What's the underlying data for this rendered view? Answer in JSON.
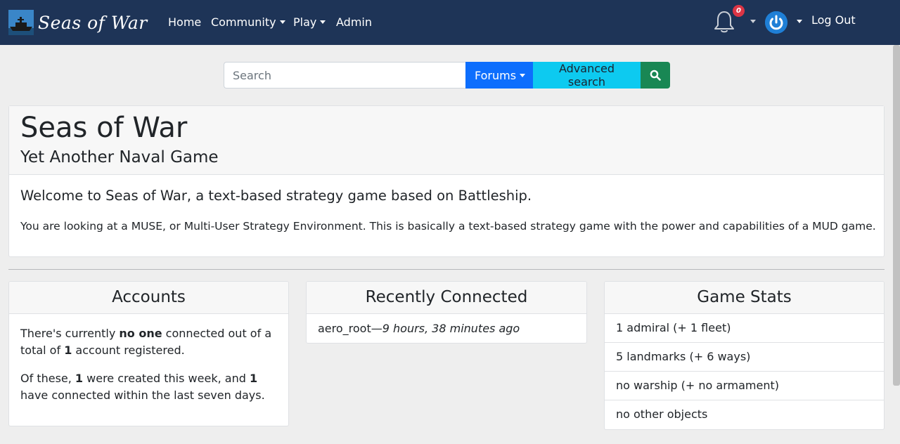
{
  "nav": {
    "brand": "Seas of War",
    "links": {
      "home": "Home",
      "community": "Community",
      "play": "Play",
      "admin": "Admin"
    },
    "notification_count": "0",
    "logout": "Log Out",
    "icons": [
      "ship-logo-icon",
      "bell-icon",
      "power-icon",
      "search-icon"
    ]
  },
  "search": {
    "placeholder": "Search",
    "forums_label": "Forums",
    "advanced_label": "Advanced search"
  },
  "hero": {
    "title": "Seas of War",
    "subtitle": "Yet Another Naval Game",
    "lead": "Welcome to Seas of War, a text-based strategy game based on Battleship.",
    "text": "You are looking at a MUSE, or Multi-User Strategy Environment. This is basically a text-based strategy game with the power and capabilities of a MUD game."
  },
  "accounts": {
    "title": "Accounts",
    "p1": {
      "a": "There's currently ",
      "b": "no one",
      "c": " connected out of a total of ",
      "d": "1",
      "e": " account registered."
    },
    "p2": {
      "a": "Of these, ",
      "b": "1",
      "c": " were created this week, and ",
      "d": "1",
      "e": " have connected within the last seven days."
    }
  },
  "recent": {
    "title": "Recently Connected",
    "items": [
      {
        "name": "aero_root",
        "sep": "—",
        "when": "9 hours, 38 minutes ago"
      }
    ]
  },
  "stats": {
    "title": "Game Stats",
    "items": [
      "1 admiral (+ 1 fleet)",
      "5 landmarks (+ 6 ways)",
      "no warship (+ no armament)",
      "no other objects"
    ]
  },
  "colors": {
    "navbar": "#1e3457",
    "primary": "#0d6efd",
    "info": "#0dcaf0",
    "success": "#198754",
    "danger": "#dc3545"
  }
}
